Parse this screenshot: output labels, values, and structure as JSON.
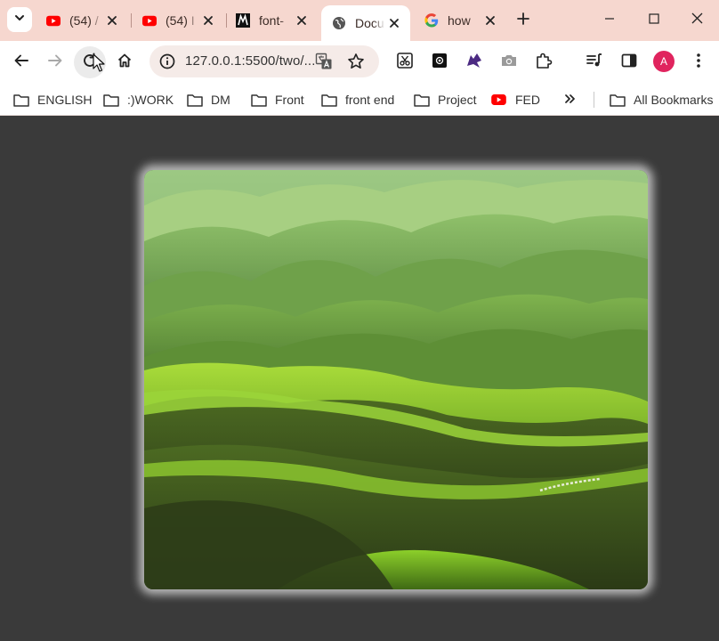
{
  "tabs": [
    {
      "title": "(54) /",
      "icon": "youtube-icon"
    },
    {
      "title": "(54) I",
      "icon": "youtube-icon"
    },
    {
      "title": "font-",
      "icon": "m-logo-icon"
    },
    {
      "title": "Docu",
      "icon": "globe-icon",
      "active": true
    },
    {
      "title": "how",
      "icon": "google-icon"
    }
  ],
  "toolbar": {
    "url": "127.0.0.1:5500/two/...",
    "avatar_letter": "A"
  },
  "bookmarks": [
    {
      "label": "ENGLISH",
      "icon": "folder-icon"
    },
    {
      "label": ":)WORK",
      "icon": "folder-icon"
    },
    {
      "label": "DM",
      "icon": "folder-icon"
    },
    {
      "label": "Front",
      "icon": "folder-icon"
    },
    {
      "label": "front end",
      "icon": "folder-icon"
    },
    {
      "label": "Project",
      "icon": "folder-icon"
    },
    {
      "label": "FED",
      "icon": "youtube-icon"
    }
  ],
  "all_bookmarks_label": "All Bookmarks",
  "colors": {
    "tabstrip_bg": "#f6d7cf",
    "page_bg": "#3a3a3a",
    "youtube_red": "#ff0000",
    "avatar_bg": "#e0245e"
  },
  "image": {
    "subject": "green rolling hills landscape photo"
  }
}
